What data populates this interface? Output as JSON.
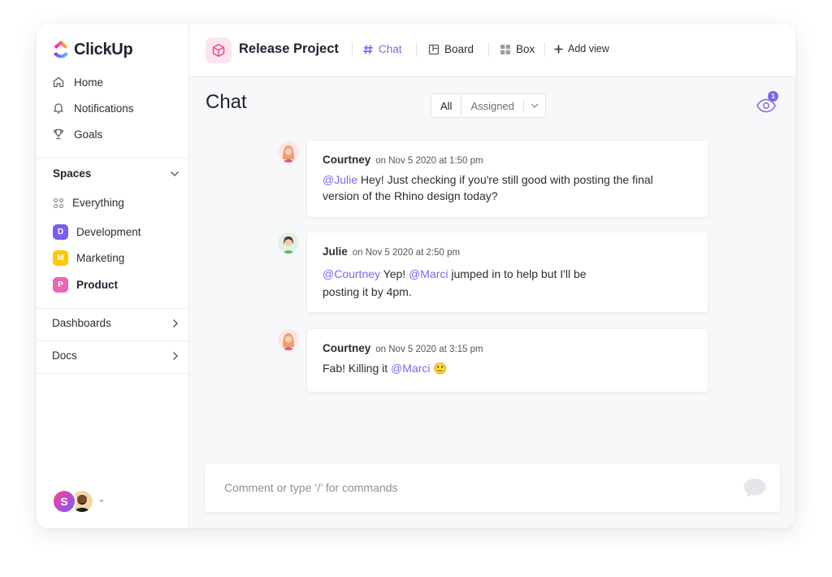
{
  "app": {
    "name": "ClickUp"
  },
  "sidebar": {
    "nav": [
      {
        "label": "Home",
        "icon": "home-icon"
      },
      {
        "label": "Notifications",
        "icon": "bell-icon"
      },
      {
        "label": "Goals",
        "icon": "trophy-icon"
      }
    ],
    "spaces_label": "Spaces",
    "spaces": [
      {
        "label": "Everything",
        "badge": "",
        "color": ""
      },
      {
        "label": "Development",
        "badge": "D",
        "color": "#7b5cf0"
      },
      {
        "label": "Marketing",
        "badge": "M",
        "color": "#ffc800"
      },
      {
        "label": "Product",
        "badge": "P",
        "color": "#f062b4"
      }
    ],
    "links": [
      {
        "label": "Dashboards"
      },
      {
        "label": "Docs"
      }
    ],
    "user_initial": "S"
  },
  "header": {
    "project_title": "Release Project",
    "tabs": [
      {
        "label": "Chat",
        "icon": "hash-icon",
        "active": true
      },
      {
        "label": "Board",
        "icon": "board-icon",
        "active": false
      },
      {
        "label": "Box",
        "icon": "box-icon",
        "active": false
      }
    ],
    "add_view_label": "Add view"
  },
  "chat": {
    "title": "Chat",
    "filters": {
      "all": "All",
      "assigned": "Assigned"
    },
    "watchers_count": "1",
    "messages": [
      {
        "author": "Courtney",
        "time": "on Nov 5 2020 at 1:50 pm",
        "parts": [
          {
            "type": "mention",
            "text": "@Julie"
          },
          {
            "type": "text",
            "text": " Hey! Just checking if you're still good with posting the final version of the Rhino design today?"
          }
        ]
      },
      {
        "author": "Julie",
        "time": "on Nov 5 2020 at 2:50 pm",
        "parts": [
          {
            "type": "mention",
            "text": "@Courtney"
          },
          {
            "type": "text",
            "text": " Yep! "
          },
          {
            "type": "mention",
            "text": "@Marci"
          },
          {
            "type": "text",
            "text": " jumped in to help but I'll be posting it by 4pm."
          }
        ]
      },
      {
        "author": "Courtney",
        "time": "on Nov 5 2020 at 3:15 pm",
        "parts": [
          {
            "type": "text",
            "text": "Fab! Killing it "
          },
          {
            "type": "mention",
            "text": "@Marci"
          },
          {
            "type": "emoji",
            "text": "🙂"
          }
        ]
      }
    ],
    "composer_placeholder": "Comment or type ‘/’ for commands"
  },
  "colors": {
    "accent": "#7b68ee"
  }
}
